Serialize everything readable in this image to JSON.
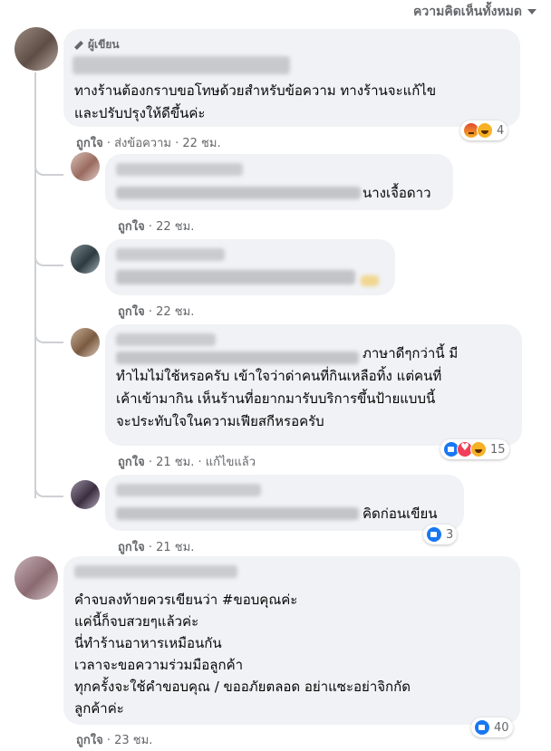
{
  "header": {
    "all_comments_label": "ความคิดเห็นทั้งหมด"
  },
  "colors": {
    "like_blue": "#1877f2",
    "meta_gray": "#65676b",
    "bubble_gray": "#f0f2f5"
  },
  "comments": [
    {
      "author_badge": "ผู้เขียน",
      "lines": [
        "ทางร้านต้องกราบขอโทษด้วยสำหรับข้อความ ทางร้านจะแก้ไข",
        "และปรับปรุงให้ดีขึ้นค่ะ"
      ],
      "like": "ถูกใจ",
      "send": "ส่งข้อความ",
      "time": "22 ชม.",
      "reaction_count": "4",
      "reactions": [
        "angry-icon",
        "haha-icon"
      ]
    },
    {
      "lines": [
        "นางเจื้อดาว"
      ],
      "like": "ถูกใจ",
      "time": "22 ชม."
    },
    {
      "lines": [],
      "like": "ถูกใจ",
      "time": "22 ชม."
    },
    {
      "lines": [
        "ภาษาดีๆกว่านี้ มี",
        "ทำไมไม่ใช้หรอครับ เข้าใจว่าด่าคนที่กินเหลือทิ้ง แต่คนที่",
        "เค้าเข้ามากิน เห็นร้านที่อยากมารับบริการขึ้นป้ายแบบนี้",
        "จะประทับใจในความเฟียสกีหรอครับ"
      ],
      "like": "ถูกใจ",
      "time": "21 ชม.",
      "edited": "แก้ไขแล้ว",
      "reaction_count": "15",
      "reactions": [
        "like-icon",
        "love-icon",
        "haha-icon"
      ]
    },
    {
      "lines": [
        "คิดก่อนเขียน"
      ],
      "like": "ถูกใจ",
      "time": "21 ชม.",
      "reaction_count": "3",
      "reactions": [
        "like-icon"
      ]
    },
    {
      "lines": [
        "คำจบลงท้ายควรเขียนว่า #ขอบคุณค่ะ",
        "แค่นี้ก็จบสวยๆแล้วค่ะ",
        "นี่ทำร้านอาหารเหมือนกัน",
        "เวลาจะขอความร่วมมือลูกค้า",
        "ทุกครั้งจะใช้คำขอบคุณ / ขออภัยตลอด อย่าแซะอย่าจิกกัด",
        "ลูกค้าค่ะ"
      ],
      "like": "ถูกใจ",
      "time": "23 ชม.",
      "reaction_count": "40",
      "reactions": [
        "like-icon"
      ]
    }
  ]
}
